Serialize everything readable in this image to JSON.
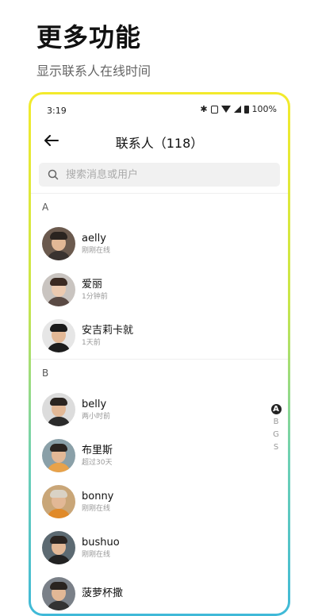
{
  "promo": {
    "title": "更多功能",
    "subtitle": "显示联系人在线时间"
  },
  "status_bar": {
    "time": "3:19",
    "battery": "100%",
    "icons": [
      "bluetooth-icon",
      "vibrate-icon",
      "wifi-icon",
      "cell-signal-icon",
      "battery-icon"
    ]
  },
  "nav": {
    "back_icon": "arrow-left-icon",
    "title": "联系人（118）"
  },
  "search": {
    "placeholder": "搜索消息或用户",
    "icon": "search-icon"
  },
  "sections": [
    {
      "letter": "A",
      "contacts": [
        {
          "name": "aelly",
          "status": "刚刚在线"
        },
        {
          "name": "爱丽",
          "status": "1分钟前"
        },
        {
          "name": "安吉莉卡就",
          "status": "1天前"
        }
      ]
    },
    {
      "letter": "B",
      "contacts": [
        {
          "name": "belly",
          "status": "两小时前"
        },
        {
          "name": "布里斯",
          "status": "超过30天"
        },
        {
          "name": "bonny",
          "status": "刚刚在线"
        },
        {
          "name": "bushuo",
          "status": "刚刚在线"
        },
        {
          "name": "菠萝杯撒",
          "status": ""
        }
      ]
    }
  ],
  "index_bar": {
    "letters": [
      "A",
      "B",
      "G",
      "S"
    ],
    "active": "A"
  },
  "colors": {
    "frame_gradient_top": "#f3ea2c",
    "frame_gradient_bottom": "#3fb9d8",
    "search_bg": "#f1f1f1"
  }
}
